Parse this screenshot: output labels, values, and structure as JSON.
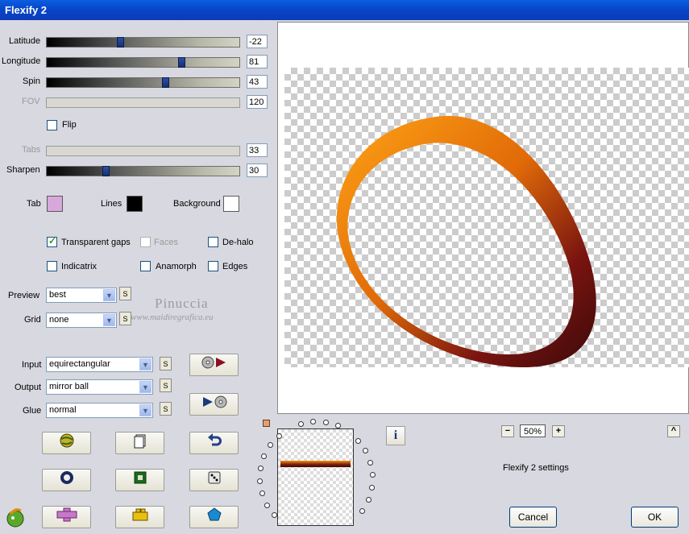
{
  "window": {
    "title": "Flexify 2"
  },
  "sliders": [
    {
      "label": "Latitude",
      "value": "-22",
      "enabled": true,
      "position": 0.38
    },
    {
      "label": "Longitude",
      "value": "81",
      "enabled": true,
      "position": 0.71
    },
    {
      "label": "Spin",
      "value": "43",
      "enabled": true,
      "position": 0.62
    },
    {
      "label": "FOV",
      "value": "120",
      "enabled": false,
      "position": 0
    },
    {
      "label": "Tabs",
      "value": "33",
      "enabled": false,
      "position": 0
    },
    {
      "label": "Sharpen",
      "value": "30",
      "enabled": true,
      "position": 0.3
    }
  ],
  "flip": {
    "label": "Flip",
    "checked": false
  },
  "colors": {
    "tab": {
      "label": "Tab",
      "color": "#d8a8dc"
    },
    "lines": {
      "label": "Lines",
      "color": "#000000"
    },
    "background": {
      "label": "Background",
      "color": "#ffffff"
    }
  },
  "options": {
    "transparent_gaps": {
      "label": "Transparent gaps",
      "checked": true
    },
    "faces": {
      "label": "Faces",
      "checked": false,
      "enabled": false
    },
    "de_halo": {
      "label": "De-halo",
      "checked": false
    },
    "indicatrix": {
      "label": "Indicatrix",
      "checked": false
    },
    "anamorph": {
      "label": "Anamorph",
      "checked": false
    },
    "edges": {
      "label": "Edges",
      "checked": false
    }
  },
  "dropdowns": {
    "preview": {
      "label": "Preview",
      "value": "best"
    },
    "grid": {
      "label": "Grid",
      "value": "none"
    },
    "input": {
      "label": "Input",
      "value": "equirectangular"
    },
    "output": {
      "label": "Output",
      "value": "mirror ball"
    },
    "glue": {
      "label": "Glue",
      "value": "normal"
    }
  },
  "s_label": "S",
  "watermark": {
    "line1": "Pinuccia",
    "line2": "www.maidiregrafica.eu"
  },
  "zoom": {
    "value": "50%",
    "minus": "−",
    "plus": "+"
  },
  "settings_label": "Flexify 2 settings",
  "info_label": "i",
  "collapse_label": "^",
  "buttons": {
    "cancel": "Cancel",
    "ok": "OK"
  },
  "accent_colors": {
    "ring_orange": "#f28a10",
    "ring_dark": "#5a0f0f",
    "titlebar": "#0a4fd6"
  }
}
